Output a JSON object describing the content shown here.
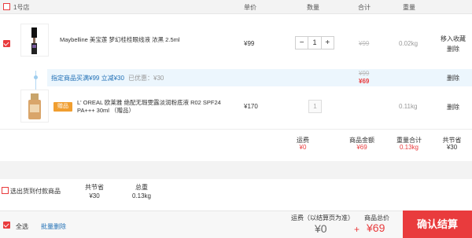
{
  "header": {
    "store": "1号店",
    "unit_price": "单价",
    "quantity": "数量",
    "subtotal": "合计",
    "weight": "重量"
  },
  "items": [
    {
      "name": "Maybelline 美宝莲 梦幻桂桂眼线液 浓黑 2.5ml",
      "price": "¥99",
      "qty": "1",
      "subtotal": "¥99",
      "weight": "0.02kg",
      "action_favorite": "移入收藏",
      "action_delete": "删除"
    },
    {
      "gift_tag": "赠品",
      "name": "L' OREAL 欧莱雅 绝配无瑕雯露淡润粉底液 R02 SPF24 PA+++ 30ml （赠品）",
      "price": "¥170",
      "qty": "1",
      "weight": "0.11kg",
      "action_delete": "删除"
    }
  ],
  "promo": {
    "text": "指定商品买满¥99 立减¥30",
    "discount_label": "已优惠：",
    "discount_value": "¥30",
    "strike_price": "¥99",
    "final_price": "¥69",
    "action_delete": "删除"
  },
  "summary": {
    "shipping_label": "运费",
    "shipping_value": "¥0",
    "amount_label": "商品金额",
    "amount_value": "¥69",
    "weight_label": "重量合计",
    "weight_value": "0.13kg",
    "saved_label": "共节省",
    "saved_value": "¥30"
  },
  "footer": {
    "select_checkout": "选出货到付款商品",
    "saved_label": "共节省",
    "saved_value": "¥30",
    "total_weight_label": "总重",
    "total_weight_value": "0.13kg",
    "select_all": "全选",
    "batch_delete": "批量删除",
    "shipping_label": "运费（以结算页为准）",
    "shipping_value": "¥0",
    "plus": "+",
    "total_label": "商品总价",
    "total_value": "¥69",
    "confirm": "确认结算"
  },
  "colors": {
    "accent": "#e93b3d",
    "promo_bg": "#ecf6fd",
    "gift_tag": "#f09e30"
  }
}
